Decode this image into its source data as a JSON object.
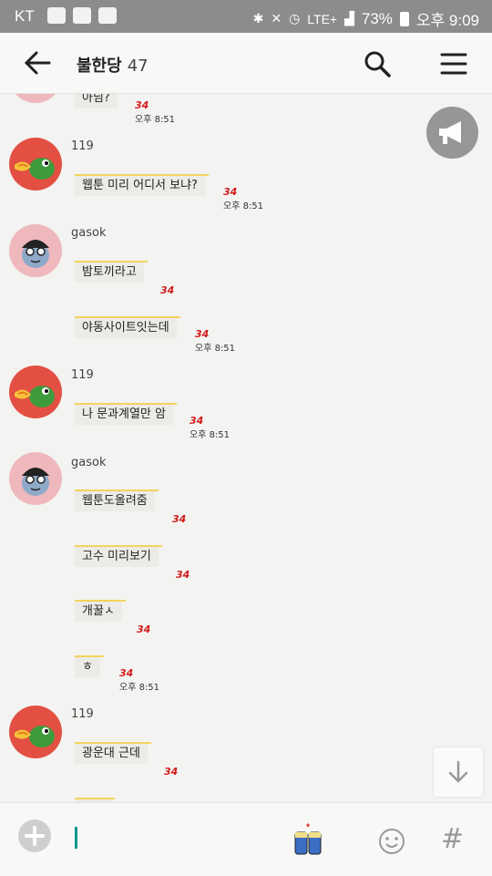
{
  "status_bar": {
    "carrier": "KT",
    "network": "LTE+",
    "battery": "73%",
    "clock": "오후 9:09"
  },
  "header": {
    "title": "불한당",
    "member_count": "47"
  },
  "chat": {
    "msg0": {
      "text": "아님?",
      "unread": "34",
      "time": "오후 8:51"
    },
    "g1": {
      "sender": "119",
      "text": "웹툰 미리 어디서 보냐?",
      "unread": "34",
      "time": "오후 8:51"
    },
    "g2": {
      "sender": "gasok",
      "text1": "밤토끼라고",
      "unread1": "34",
      "text2": "야동사이트잇는데",
      "unread2": "34",
      "time": "오후 8:51"
    },
    "g3": {
      "sender": "119",
      "text": "나 문과계열만 암",
      "unread": "34",
      "time": "오후 8:51"
    },
    "g4": {
      "sender": "gasok",
      "text1": "웹툰도올려줌",
      "unread1": "34",
      "text2": "고수 미리보기",
      "unread2": "34",
      "text3": "개꿀ㅅ",
      "unread3": "34",
      "text4": "ㅎ",
      "unread4": "34",
      "time": "오후 8:51"
    },
    "g5": {
      "sender": "119",
      "text1": "광운대 근데",
      "unread1": "34"
    }
  },
  "icons": {
    "back": "back-arrow-icon",
    "search": "search-icon",
    "menu": "hamburger-menu-icon",
    "notice": "megaphone-icon",
    "scroll_down": "arrow-down-icon",
    "plus": "plus-icon",
    "emoticon": "smiley-icon",
    "hash": "hashtag-icon"
  },
  "colors": {
    "unread": "#d21c1c",
    "bubble_accent": "#f4d35e",
    "caret": "#009a8e"
  }
}
